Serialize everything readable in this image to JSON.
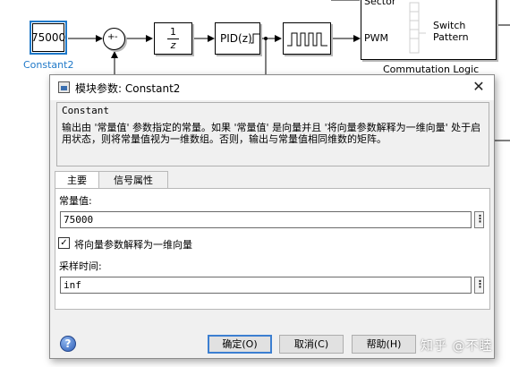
{
  "model": {
    "constant_value": "75000",
    "constant_caption": "Constant2",
    "sum_sign": "+",
    "sum_sign2": "-",
    "delay_num": "1",
    "delay_den": "z",
    "pid_label": "PID(z)",
    "port_sector": "Sector",
    "port_pwm": "PWM",
    "port_switch": "Switch Pattern",
    "subsystem_caption": "Commutation Logic"
  },
  "dialog": {
    "title": "模块参数: Constant2",
    "block_type": "Constant",
    "description": "输出由 '常量值' 参数指定的常量。如果 '常量值' 是向量并且 '将向量参数解释为一维向量' 处于启用状态，则将常量值视为一维数组。否则，输出与常量值相同维数的矩阵。",
    "tabs": [
      {
        "label": "主要",
        "active": true
      },
      {
        "label": "信号属性",
        "active": false
      }
    ],
    "constant_label": "常量值:",
    "constant_value": "75000",
    "checkbox_label": "将向量参数解释为一维向量",
    "checkbox_checked": true,
    "sample_time_label": "采样时间:",
    "sample_time_value": "inf",
    "buttons": {
      "ok": "确定(O)",
      "cancel": "取消(C)",
      "help": "帮助(H)"
    }
  },
  "watermark": "知乎 @不睦",
  "colors": {
    "selection": "#1e78c8",
    "dialog_bg": "#f0f0f0",
    "default_button_border": "#3c7fd1"
  }
}
